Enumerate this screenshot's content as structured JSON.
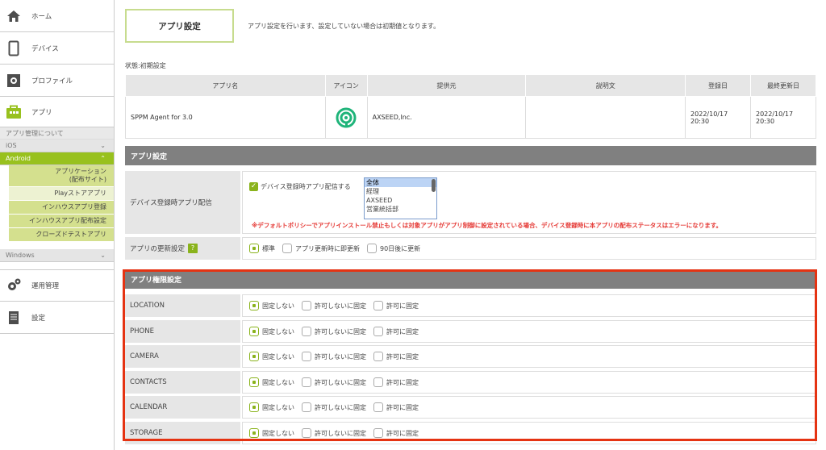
{
  "sidebar": {
    "home": "ホーム",
    "devices": "デバイス",
    "profiles": "プロファイル",
    "apps": "アプリ",
    "app_mgmt_about": "アプリ管理について",
    "ios": "iOS",
    "android": "Android",
    "android_links": [
      "アプリケーション\n(配布サイト)",
      "Playストアアプリ",
      "インハウスアプリ登録",
      "インハウスアプリ配布設定",
      "クローズドテストアプリ"
    ],
    "windows": "Windows",
    "operations": "運用管理",
    "settings": "設定"
  },
  "header": {
    "title": "アプリ設定",
    "description": "アプリ設定を行います、設定していない場合は初期値となります。",
    "status": "状態:初期設定"
  },
  "app_table": {
    "columns": [
      "アプリ名",
      "アイコン",
      "提供元",
      "説明文",
      "登録日",
      "最終更新日"
    ],
    "row": {
      "name": "SPPM Agent for 3.0",
      "provider": "AXSEED,Inc.",
      "description": "",
      "registered": "2022/10/17\n20:30",
      "updated": "2022/10/17\n20:30"
    }
  },
  "app_settings": {
    "section_title": "アプリ設定",
    "device_dist_label": "デバイス登録時アプリ配信",
    "device_dist_checkbox": "デバイス登録時アプリ配信する",
    "groups": [
      "全体",
      "経理",
      "AXSEED",
      "営業統括部"
    ],
    "warning": "※デフォルトポリシーでアプリインストール禁止もしくは対象アプリがアプリ制御に設定されている場合、デバイス登録時に本アプリの配布ステータスはエラーになります。",
    "update_label": "アプリの更新設定",
    "update_help": "?",
    "update_options": [
      "標準",
      "アプリ更新時に即更新",
      "90日後に更新"
    ]
  },
  "permissions": {
    "section_title": "アプリ権限設定",
    "options": [
      "固定しない",
      "許可しないに固定",
      "許可に固定"
    ],
    "items": [
      "LOCATION",
      "PHONE",
      "CAMERA",
      "CONTACTS",
      "CALENDAR",
      "STORAGE"
    ]
  },
  "colors": {
    "accent": "#98c11e",
    "highlight": "#e53312",
    "section": "#808080"
  }
}
